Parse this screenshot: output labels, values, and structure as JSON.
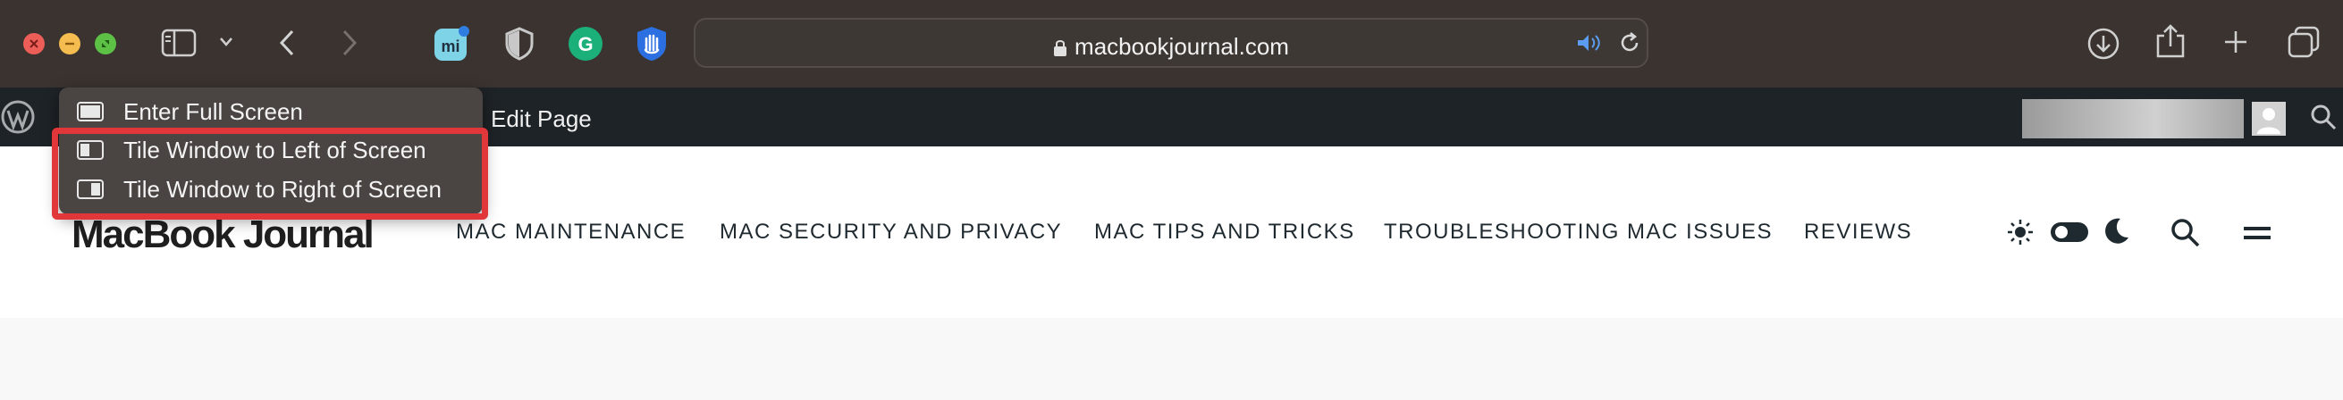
{
  "browser": {
    "url": "macbookjournal.com",
    "window_controls": [
      "close-button",
      "minimize-button",
      "zoom-button"
    ],
    "extensions": [
      "moodle-extension-icon",
      "privacy-shield-icon",
      "grammarly-icon",
      "hand-blocker-icon"
    ]
  },
  "window_menu": {
    "items": [
      {
        "label": "Enter Full Screen",
        "icon": "full-screen-icon"
      },
      {
        "label": "Tile Window to Left of Screen",
        "icon": "tile-left-icon"
      },
      {
        "label": "Tile Window to Right of Screen",
        "icon": "tile-right-icon"
      }
    ],
    "highlight_color": "#e2373a"
  },
  "adminbar": {
    "edit_page": "Edit Page"
  },
  "site": {
    "logo": "MacBook Journal",
    "nav": [
      "MAC MAINTENANCE",
      "MAC SECURITY AND PRIVACY",
      "MAC TIPS AND TRICKS",
      "TROUBLESHOOTING MAC ISSUES",
      "REVIEWS"
    ]
  },
  "colors": {
    "toolbar": "#3a3330",
    "adminbar": "#1e2327",
    "close": "#ee5e58",
    "minimize": "#f5bd4f",
    "zoom": "#5dc146"
  }
}
